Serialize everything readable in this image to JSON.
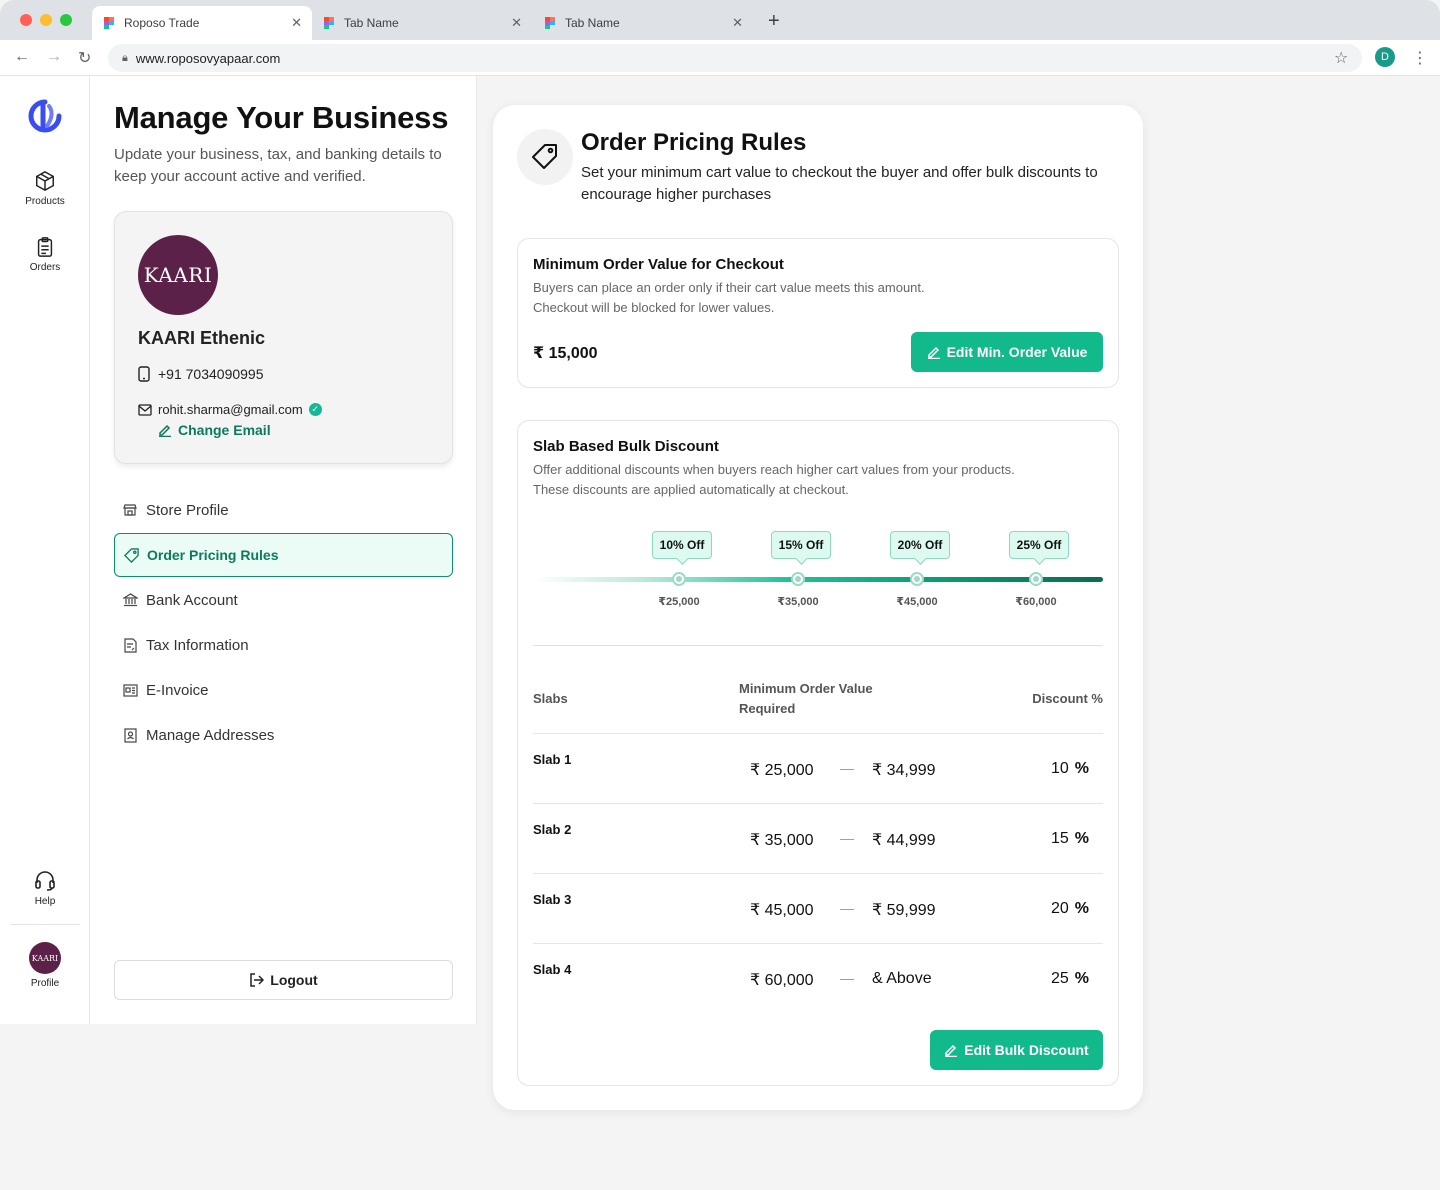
{
  "browser": {
    "tabs": [
      {
        "label": "Roposo Trade"
      },
      {
        "label": "Tab Name"
      },
      {
        "label": "Tab Name"
      }
    ],
    "url": "www.roposovyapaar.com",
    "user_initial": "D"
  },
  "rail": {
    "products": "Products",
    "orders": "Orders",
    "help": "Help",
    "profile": "Profile",
    "profile_logo": "KAARI"
  },
  "panel": {
    "title": "Manage Your Business",
    "subtitle": "Update your business, tax, and banking details to keep your account active and verified.",
    "business": {
      "logo_text": "KAARI",
      "name": "KAARI Ethenic",
      "phone": "+91 7034090995",
      "email": "rohit.sharma@gmail.com",
      "change_email": "Change Email"
    },
    "menu": [
      {
        "label": "Store Profile"
      },
      {
        "label": "Order Pricing Rules"
      },
      {
        "label": "Bank Account"
      },
      {
        "label": "Tax Information"
      },
      {
        "label": "E-Invoice"
      },
      {
        "label": "Manage Addresses"
      }
    ],
    "logout": "Logout"
  },
  "main": {
    "title": "Order Pricing Rules",
    "subtitle": "Set your minimum cart value to checkout the buyer and offer bulk discounts to encourage higher purchases",
    "min_order": {
      "title": "Minimum Order Value for Checkout",
      "desc_1": "Buyers can place an order only if their cart value meets this amount.",
      "desc_2": "Checkout will be blocked for lower values.",
      "value": "₹ 15,000",
      "button": "Edit Min. Order Value"
    },
    "bulk": {
      "title": "Slab Based Bulk Discount",
      "desc_1": "Offer additional discounts when buyers reach higher cart values from your products.",
      "desc_2": "These discounts are applied automatically at checkout.",
      "slider": [
        {
          "pill": "10% Off",
          "label": "₹25,000"
        },
        {
          "pill": "15% Off",
          "label": "₹35,000"
        },
        {
          "pill": "20% Off",
          "label": "₹45,000"
        },
        {
          "pill": "25% Off",
          "label": "₹60,000"
        }
      ],
      "headers": {
        "slabs": "Slabs",
        "min_value_1": "Minimum Order Value",
        "min_value_2": "Required",
        "discount": "Discount %"
      },
      "rows": [
        {
          "slab": "Slab 1",
          "from": "₹ 25,000",
          "dash": "—",
          "to": "₹ 34,999",
          "pct": "10",
          "pct_sign": "%"
        },
        {
          "slab": "Slab 2",
          "from": "₹ 35,000",
          "dash": "—",
          "to": "₹ 44,999",
          "pct": "15",
          "pct_sign": "%"
        },
        {
          "slab": "Slab 3",
          "from": "₹ 45,000",
          "dash": "—",
          "to": "₹ 59,999",
          "pct": "20",
          "pct_sign": "%"
        },
        {
          "slab": "Slab 4",
          "from": "₹ 60,000",
          "dash": "—",
          "to": "& Above",
          "pct": "25",
          "pct_sign": "%"
        }
      ],
      "button": "Edit Bulk Discount"
    }
  },
  "colors": {
    "accent": "#12b98a",
    "accent_dark": "#0b7a5e",
    "brand_logo": "#5b2148"
  }
}
